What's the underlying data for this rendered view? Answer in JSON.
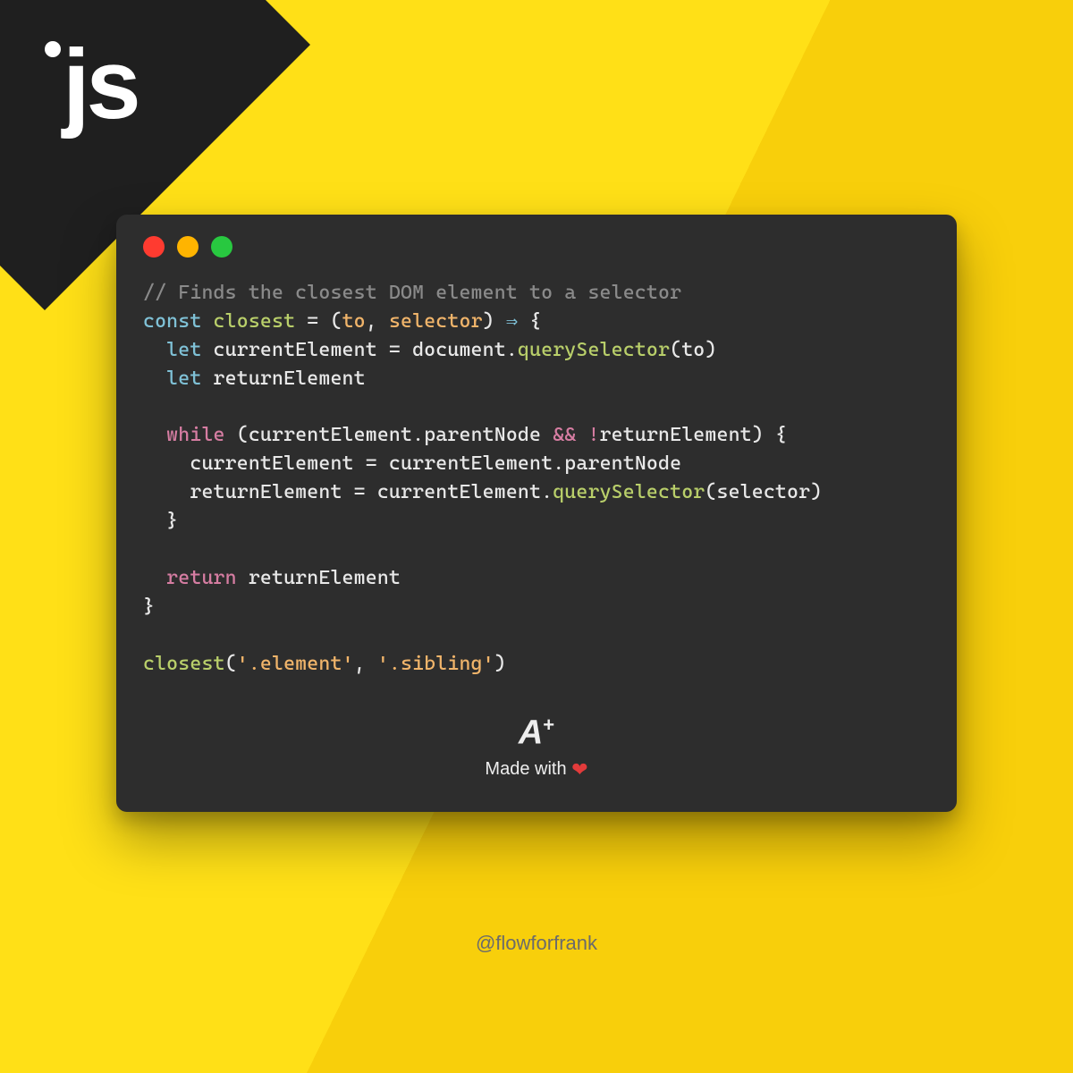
{
  "badge": "js",
  "code": {
    "l1_comment": "// Finds the closest DOM element to a selector",
    "l2_const": "const",
    "l2_fn": "closest",
    "l2_eq": " = ",
    "l2_open": "(",
    "l2_p1": "to",
    "l2_comma": ", ",
    "l2_p2": "selector",
    "l2_close": ")",
    "l2_arrow": " ⇒ ",
    "l2_brace": "{",
    "l3_let": "  let",
    "l3_var": " currentElement",
    "l3_eq": " = ",
    "l3_doc": "document",
    "l3_dot": ".",
    "l3_qs": "querySelector",
    "l3_open": "(",
    "l3_arg": "to",
    "l3_close": ")",
    "l4_let": "  let",
    "l4_var": " returnElement",
    "l6_while": "  while",
    "l6_open": " (",
    "l6_cur": "currentElement",
    "l6_dot": ".",
    "l6_pn": "parentNode",
    "l6_and": " && ",
    "l6_bang": "!",
    "l6_ret": "returnElement",
    "l6_close": ") {",
    "l7_cur": "    currentElement",
    "l7_eq": " = ",
    "l7_cur2": "currentElement",
    "l7_dot": ".",
    "l7_pn": "parentNode",
    "l8_ret": "    returnElement",
    "l8_eq": " = ",
    "l8_cur": "currentElement",
    "l8_dot": ".",
    "l8_qs": "querySelector",
    "l8_open": "(",
    "l8_arg": "selector",
    "l8_close": ")",
    "l9_brace": "  }",
    "l11_return": "  return",
    "l11_val": " returnElement",
    "l12_brace": "}",
    "l14_fn": "closest",
    "l14_open": "(",
    "l14_s1": "'.element'",
    "l14_comma": ", ",
    "l14_s2": "'.sibling'",
    "l14_close": ")"
  },
  "footer": {
    "aplus_a": "A",
    "aplus_plus": "+",
    "made": "Made with ",
    "heart": "❤"
  },
  "handle": "@flowforfrank"
}
